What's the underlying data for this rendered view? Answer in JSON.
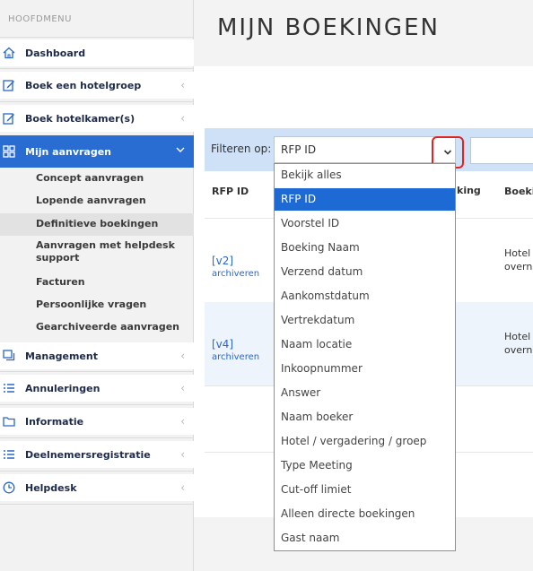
{
  "sidebar": {
    "header": "HOOFDMENU",
    "items": [
      {
        "label": "Dashboard",
        "icon": "home-icon"
      },
      {
        "label": "Boek een hotelgroep",
        "icon": "edit-icon"
      },
      {
        "label": "Boek hotelkamer(s)",
        "icon": "edit-icon"
      },
      {
        "label": "Mijn aanvragen",
        "icon": "grid-icon"
      },
      {
        "label": "Management",
        "icon": "copy-icon"
      },
      {
        "label": "Annuleringen",
        "icon": "list-icon"
      },
      {
        "label": "Informatie",
        "icon": "folder-icon"
      },
      {
        "label": "Deelnemersregistratie",
        "icon": "list-icon"
      },
      {
        "label": "Helpdesk",
        "icon": "clock-icon"
      }
    ],
    "submenu": [
      "Concept aanvragen",
      "Lopende aanvragen",
      "Definitieve boekingen",
      "Aanvragen met helpdesk support",
      "Facturen",
      "Persoonlijke vragen",
      "Gearchiveerde aanvragen"
    ]
  },
  "main": {
    "title": "MIJN BOEKINGEN",
    "filter_label": "Filteren op:",
    "filter_selected": "RFP ID",
    "columns": [
      "RFP ID",
      "king",
      "Boeki"
    ],
    "rows": [
      {
        "version": "[v2]",
        "archive": "archiveren",
        "right_line1": "Hotel",
        "right_line2": "overn"
      },
      {
        "version": "[v4]",
        "archive": "archiveren",
        "right_line1": "Hotel",
        "right_line2": "overn"
      }
    ]
  },
  "dropdown": {
    "options": [
      "Bekijk alles",
      "RFP ID",
      "Voorstel ID",
      "Boeking Naam",
      "Verzend datum",
      "Aankomstdatum",
      "Vertrekdatum",
      "Naam locatie",
      "Inkoopnummer",
      "Answer",
      "Naam boeker",
      "Hotel / vergadering / groep",
      "Type Meeting",
      "Cut-off limiet",
      "Alleen directe boekingen",
      "Gast naam"
    ],
    "highlighted": "RFP ID"
  },
  "colors": {
    "accent": "#2a6dd2",
    "highlight": "#1e6ad4",
    "filter_bar": "#cfe1f7",
    "focus_ring": "#e02424"
  }
}
